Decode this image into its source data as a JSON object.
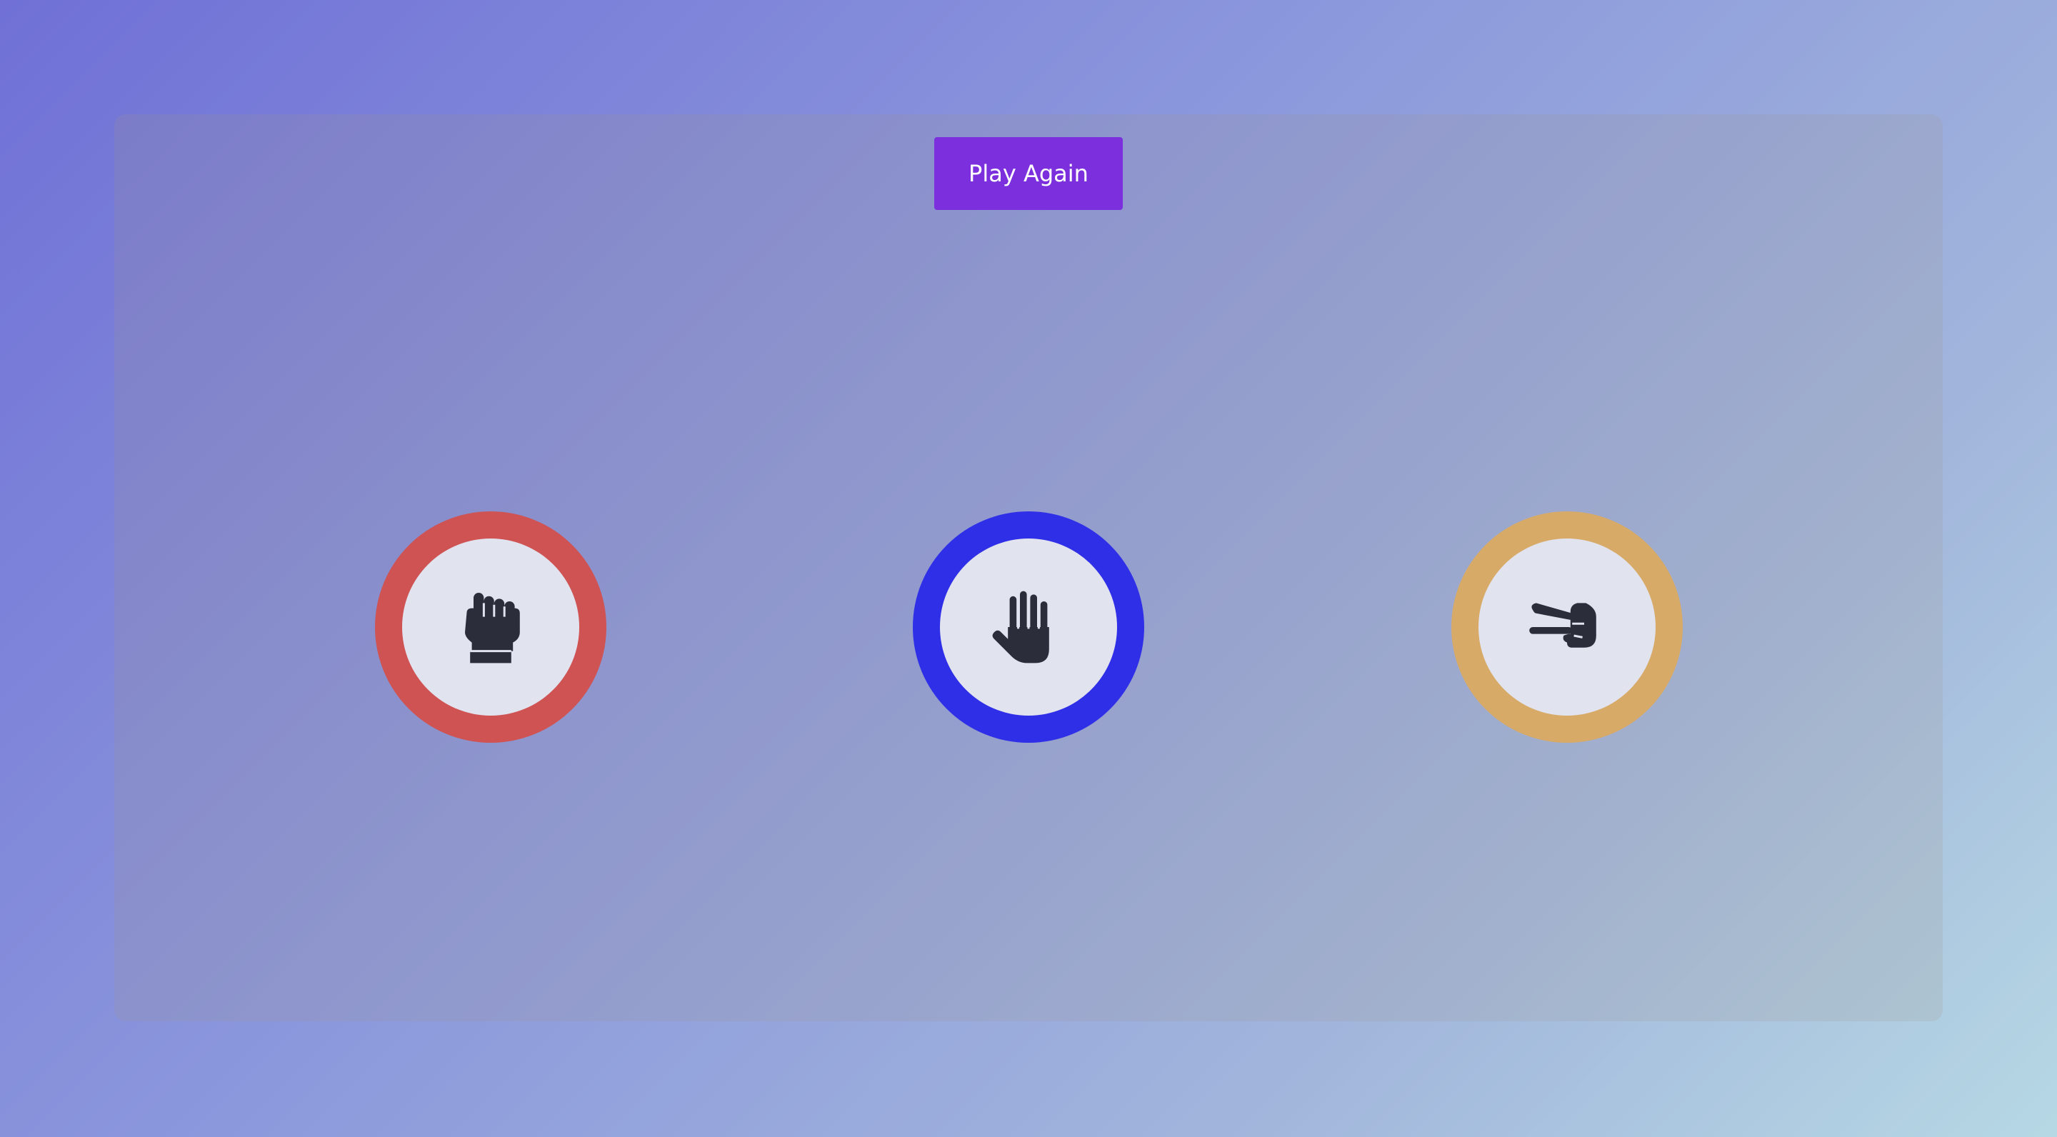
{
  "play_again_label": "Play Again",
  "choices": [
    {
      "id": "rock",
      "icon": "fist-icon",
      "ring_color": "#cf5353"
    },
    {
      "id": "paper",
      "icon": "open-hand-icon",
      "ring_color": "#2f2fe8"
    },
    {
      "id": "scissors",
      "icon": "peace-hand-icon",
      "ring_color": "#d8aa68"
    }
  ],
  "colors": {
    "button": "#7c2fdc",
    "icon": "#2b2e3a",
    "inner_circle": "#e1e3ef"
  }
}
